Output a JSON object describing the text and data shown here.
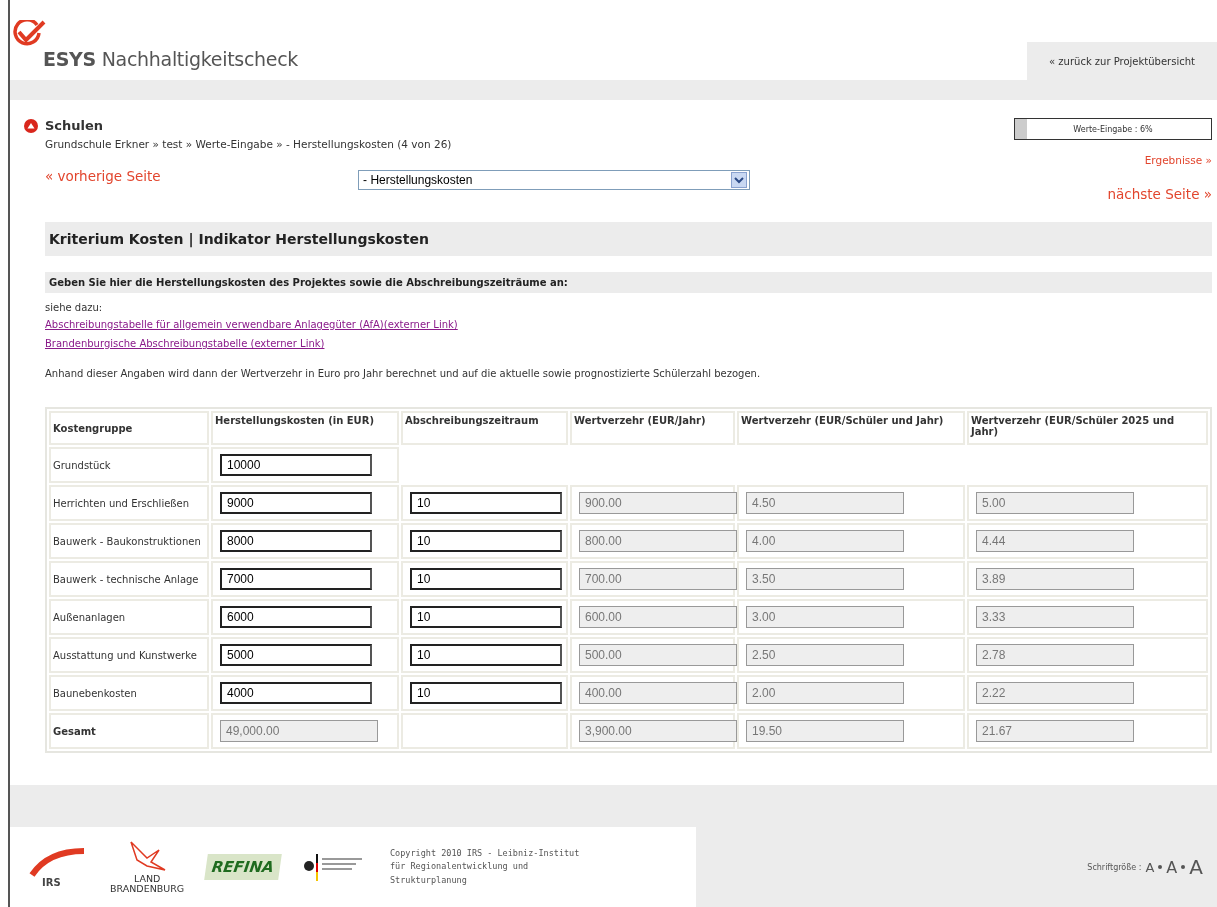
{
  "header": {
    "logo_text": "ESYS",
    "logo_subtitle": "Nachhaltigkeitscheck",
    "back_link": "« zurück zur Projektübersicht"
  },
  "section": {
    "title": "Schulen",
    "breadcrumb": "Grundschule Erkner » test » Werte-Eingabe » - Herstellungskosten (4 von 26)"
  },
  "progress": {
    "label": "Werte-Eingabe :  6%",
    "level": 0.06
  },
  "results_link": "Ergebnisse »",
  "nav": {
    "previous": "« vorherige Seite",
    "next": "nächste Seite »",
    "page_select": "- Herstellungskosten"
  },
  "panel_title": "Kriterium Kosten | Indikator Herstellungskosten",
  "instruction": "Geben Sie hier die Herstellungskosten des Projektes sowie die Abschreibungszeiträume an:",
  "see_also": "siehe dazu:",
  "links": [
    "Abschreibungstabelle für allgemein verwendbare Anlagegüter (AfA)(externer Link)",
    "Brandenburgische Abschreibungstabelle (externer Link)"
  ],
  "note": "Anhand dieser Angaben wird dann der Wertverzehr in Euro pro Jahr berechnet und auf die aktuelle sowie prognostizierte Schülerzahl bezogen.",
  "table": {
    "columns": [
      "Kostengruppe",
      "Herstellungskosten (in EUR)",
      "Abschreibungszeitraum",
      "Wertverzehr (EUR/Jahr)",
      "Wertverzehr (EUR/Schüler und Jahr)",
      "Wertverzehr (EUR/Schüler 2025 und Jahr)"
    ],
    "rows": [
      {
        "kind": "land",
        "label": "Grundstück",
        "cost": "10000"
      },
      {
        "kind": "item",
        "label": "Herrichten und Erschließen",
        "cost": "9000",
        "period": "10",
        "per_year": "900.00",
        "per_student": "4.50",
        "per_student_2025": "5.00"
      },
      {
        "kind": "item",
        "label": "Bauwerk - Baukonstruktionen",
        "cost": "8000",
        "period": "10",
        "per_year": "800.00",
        "per_student": "4.00",
        "per_student_2025": "4.44"
      },
      {
        "kind": "item",
        "label": "Bauwerk - technische Anlage",
        "cost": "7000",
        "period": "10",
        "per_year": "700.00",
        "per_student": "3.50",
        "per_student_2025": "3.89"
      },
      {
        "kind": "item",
        "label": "Außenanlagen",
        "cost": "6000",
        "period": "10",
        "per_year": "600.00",
        "per_student": "3.00",
        "per_student_2025": "3.33"
      },
      {
        "kind": "item",
        "label": "Ausstattung und Kunstwerke",
        "cost": "5000",
        "period": "10",
        "per_year": "500.00",
        "per_student": "2.50",
        "per_student_2025": "2.78"
      },
      {
        "kind": "item",
        "label": "Baunebenkosten",
        "cost": "4000",
        "period": "10",
        "per_year": "400.00",
        "per_student": "2.00",
        "per_student_2025": "2.22"
      },
      {
        "kind": "total",
        "label": "Gesamt",
        "cost": "49,000.00",
        "per_year": "3,900.00",
        "per_student": "19.50",
        "per_student_2025": "21.67"
      }
    ]
  },
  "footer": {
    "irs": "IRS",
    "land": "LAND",
    "brandenburg": "BRANDENBURG",
    "refina": "REFINA",
    "copyright": "Copyright 2010 IRS - Leibniz-Institut für Regionalentwicklung und Strukturplanung",
    "font_size_label": "Schriftgröße :",
    "font_sizes": [
      "A",
      "A",
      "A"
    ]
  }
}
